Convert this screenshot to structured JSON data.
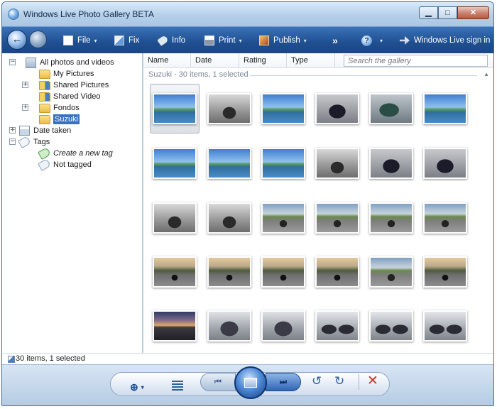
{
  "window": {
    "title": "Windows Live Photo Gallery BETA",
    "controls": {
      "minimize": "▁",
      "maximize": "□",
      "close": "✕"
    }
  },
  "toolbar": {
    "file": "File",
    "fix": "Fix",
    "info": "Info",
    "print": "Print",
    "publish": "Publish",
    "more": "»",
    "help": "?",
    "signin": "Windows Live sign in",
    "caret": "▾"
  },
  "tree": {
    "items": [
      {
        "label": "All photos and videos",
        "icon": "photos-icon"
      },
      {
        "label": "My Pictures",
        "icon": "folder-icon"
      },
      {
        "label": "Shared Pictures",
        "icon": "folder-icon"
      },
      {
        "label": "Shared Video",
        "icon": "folder-icon"
      },
      {
        "label": "Fondos",
        "icon": "folder-icon"
      },
      {
        "label": "Suzuki",
        "icon": "folder-icon",
        "selected": true
      },
      {
        "label": "Date taken",
        "icon": "calendar-icon"
      },
      {
        "label": "Tags",
        "icon": "tags-icon"
      },
      {
        "label": "Create a new tag",
        "icon": "new-tag-icon"
      },
      {
        "label": "Not tagged",
        "icon": "not-tagged-icon"
      }
    ],
    "expanders": {
      "collapse": "−",
      "expand": "+"
    }
  },
  "columns": [
    "Name",
    "Date",
    "Rating",
    "Type"
  ],
  "search": {
    "placeholder": "Search the gallery"
  },
  "group_header": "Suzuki - 30 items, 1 selected",
  "thumbnails": [
    "lake",
    "moto-light",
    "lake",
    "moto-dark",
    "moto-green",
    "lake",
    "lake",
    "lake",
    "lake",
    "moto-light",
    "moto-dark",
    "moto-dark",
    "moto-light",
    "moto-light",
    "park",
    "park",
    "park",
    "park",
    "park-dusk",
    "park-dusk",
    "park-dusk",
    "park-dusk",
    "park",
    "park-dusk",
    "sunset",
    "parked",
    "parked",
    "duo",
    "duo",
    "duo"
  ],
  "status": "30 items, 1 selected",
  "controlbar": {
    "zoom": "⊕",
    "prev": "⏮",
    "next": "⏭",
    "rotate_left": "↺",
    "rotate_right": "↻",
    "delete": "✕"
  },
  "colors": {
    "toolbar": "#1f4f91",
    "selection": "#3a70c2",
    "delete": "#c8332a"
  }
}
